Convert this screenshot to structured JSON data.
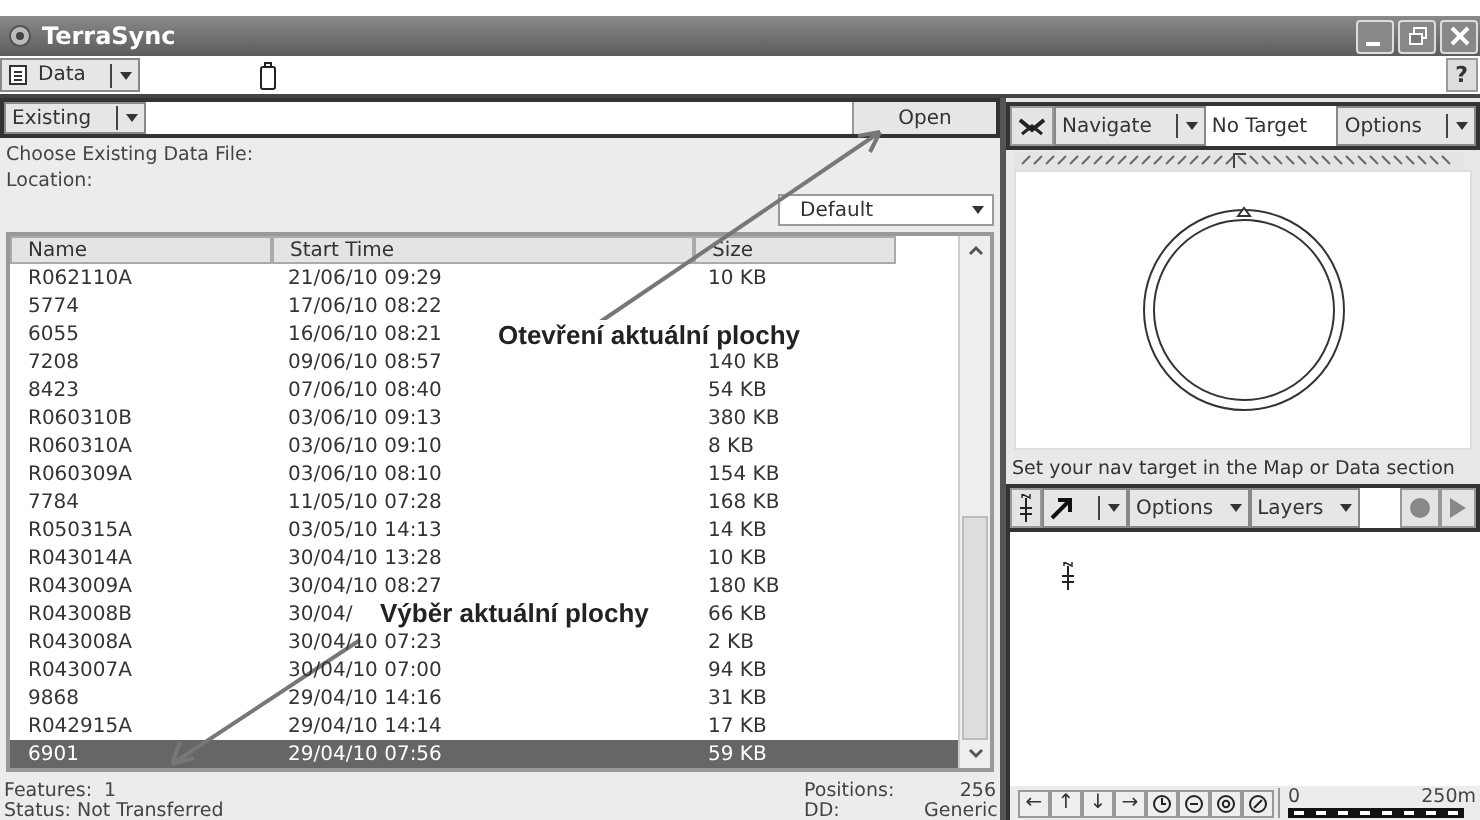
{
  "window": {
    "title": "TerraSync",
    "help": "?"
  },
  "toolbar": {
    "section": "Data"
  },
  "data_panel": {
    "mode": "Existing",
    "open_button": "Open",
    "prompt": "Choose Existing Data File:",
    "location_label": "Location:",
    "location": "Default",
    "columns": [
      "Name",
      "Start Time",
      "Size"
    ],
    "rows": [
      {
        "name": "R062110A",
        "start": "21/06/10 09:29",
        "size": "10 KB",
        "selected": false
      },
      {
        "name": "5774",
        "start": "17/06/10 08:22",
        "selected": false
      },
      {
        "name": "6055",
        "start": "16/06/10 08:21",
        "selected": false
      },
      {
        "name": "7208",
        "start": "09/06/10 08:57",
        "size": "140 KB",
        "selected": false
      },
      {
        "name": "8423",
        "start": "07/06/10 08:40",
        "size": "54 KB",
        "selected": false
      },
      {
        "name": "R060310B",
        "start": "03/06/10 09:13",
        "size": "380 KB",
        "selected": false
      },
      {
        "name": "R060310A",
        "start": "03/06/10 09:10",
        "size": "8 KB",
        "selected": false
      },
      {
        "name": "R060309A",
        "start": "03/06/10 08:10",
        "size": "154 KB",
        "selected": false
      },
      {
        "name": "7784",
        "start": "11/05/10 07:28",
        "size": "168 KB",
        "selected": false
      },
      {
        "name": "R050315A",
        "start": "03/05/10 14:13",
        "size": "14 KB",
        "selected": false
      },
      {
        "name": "R043014A",
        "start": "30/04/10 13:28",
        "size": "10 KB",
        "selected": false
      },
      {
        "name": "R043009A",
        "start": "30/04/10 08:27",
        "size": "180 KB",
        "selected": false
      },
      {
        "name": "R043008B",
        "start": "30/04/",
        "size": "66 KB",
        "selected": false
      },
      {
        "name": "R043008A",
        "start": "30/04/10 07:23",
        "size": "2 KB",
        "selected": false
      },
      {
        "name": "R043007A",
        "start": "30/04/10 07:00",
        "size": "94 KB",
        "selected": false
      },
      {
        "name": "9868",
        "start": "29/04/10 14:16",
        "size": "31 KB",
        "selected": false
      },
      {
        "name": "R042915A",
        "start": "29/04/10 14:14",
        "size": "17 KB",
        "selected": false
      },
      {
        "name": "6901",
        "start": "29/04/10 07:56",
        "size": "59 KB",
        "selected": true
      }
    ],
    "features_label": "Features:",
    "features": "1",
    "status": "Status: Not Transferred",
    "positions_label": "Positions:",
    "positions": "256",
    "dd_label": "DD:",
    "dd": "Generic"
  },
  "navigation": {
    "mode": "Navigate",
    "target": "No Target",
    "options": "Options",
    "hint": "Set your nav target in the Map or Data section"
  },
  "map": {
    "options": "Options",
    "layers": "Layers",
    "pan_buttons": [
      "←",
      "↑",
      "↓",
      "→"
    ],
    "scale_start": "0",
    "scale_end": "250m"
  },
  "annotations": [
    {
      "text": "Otevření aktuální plochy"
    },
    {
      "text": "Výběr aktuální plochy"
    }
  ]
}
